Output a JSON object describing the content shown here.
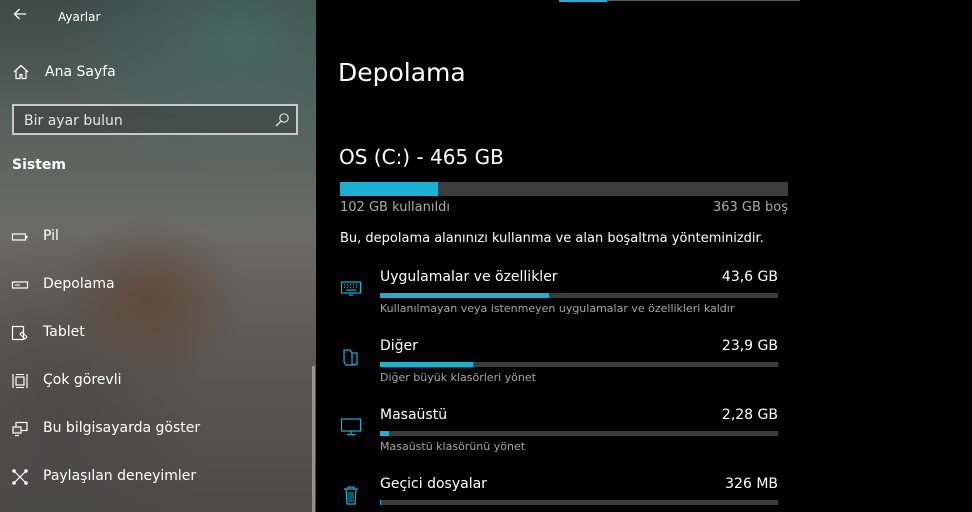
{
  "sidebar": {
    "app_title": "Ayarlar",
    "back_icon": "arrow-left-icon",
    "home_label": "Ana Sayfa",
    "search_placeholder": "Bir ayar bulun",
    "section_heading": "Sistem",
    "items": [
      {
        "label": "Pil",
        "icon": "battery-icon"
      },
      {
        "label": "Depolama",
        "icon": "storage-drive-icon"
      },
      {
        "label": "Tablet",
        "icon": "tablet-icon"
      },
      {
        "label": "Çok görevli",
        "icon": "multitasking-icon"
      },
      {
        "label": "Bu bilgisayarda göster",
        "icon": "project-screen-icon"
      },
      {
        "label": "Paylaşılan deneyimler",
        "icon": "shared-experiences-icon"
      }
    ]
  },
  "main": {
    "title": "Depolama",
    "drive": {
      "name": "OS (C:) - 465 GB",
      "used_label": "102 GB kullanıldı",
      "free_label": "363 GB boş",
      "used_fraction": 0.219
    },
    "description": "Bu, depolama alanınızı kullanma ve alan boşaltma yönteminizdir.",
    "categories": [
      {
        "name": "Uygulamalar ve özellikler",
        "size": "43,6 GB",
        "sub": "Kullanılmayan veya istenmeyen uygulamalar ve özellikleri kaldır",
        "fraction": 0.425,
        "icon": "apps-keyboard-icon"
      },
      {
        "name": "Diğer",
        "size": "23,9 GB",
        "sub": "Diğer büyük klasörleri yönet",
        "fraction": 0.234,
        "icon": "other-folder-icon"
      },
      {
        "name": "Masaüstü",
        "size": "2,28 GB",
        "sub": "Masaüstü klasörünü yönet",
        "fraction": 0.022,
        "icon": "desktop-monitor-icon"
      },
      {
        "name": "Geçici dosyalar",
        "size": "326 MB",
        "sub": "",
        "fraction": 0.003,
        "icon": "trash-icon"
      }
    ]
  },
  "colors": {
    "accent": "#19b1d4",
    "bar_track": "#3c3c3c"
  }
}
